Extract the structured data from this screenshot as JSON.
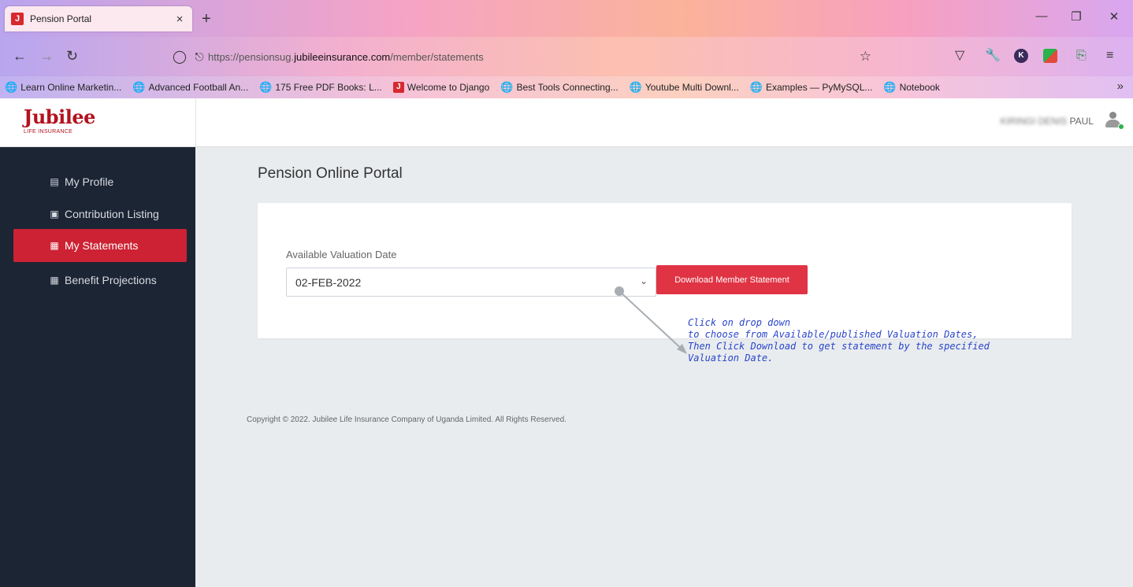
{
  "browser": {
    "tab_title": "Pension Portal",
    "tab_favicon": "J",
    "tab_close": "×",
    "new_tab": "+",
    "url_prefix": "https://pensionsug.",
    "url_host": "jubileeinsurance.com",
    "url_path": "/member/statements",
    "extension_k": "K",
    "bookmarks": [
      {
        "label": "Learn Online Marketin...",
        "icon": "globe-icon"
      },
      {
        "label": "Advanced Football An...",
        "icon": "globe-icon"
      },
      {
        "label": "175 Free PDF Books: L...",
        "icon": "globe-icon"
      },
      {
        "label": "Welcome to Django",
        "icon": "jubilee-favicon"
      },
      {
        "label": "Best Tools Connecting...",
        "icon": "globe-icon"
      },
      {
        "label": "Youtube Multi Downl...",
        "icon": "globe-icon"
      },
      {
        "label": "Examples — PyMySQL...",
        "icon": "globe-icon"
      },
      {
        "label": "Notebook",
        "icon": "globe-icon"
      }
    ]
  },
  "header": {
    "brand_name": "Jubilee",
    "brand_sub": "LIFE INSURANCE",
    "user_blurred": "KIRINGI DENIS",
    "user_last": "PAUL"
  },
  "sidebar": {
    "items": [
      {
        "label": "My Profile",
        "icon": "id-card-icon"
      },
      {
        "label": "Contribution Listing",
        "icon": "money-icon"
      },
      {
        "label": "My Statements",
        "icon": "newspaper-icon"
      },
      {
        "label": "Benefit Projections",
        "icon": "newspaper-icon"
      }
    ]
  },
  "main": {
    "title": "Pension Online Portal",
    "field_label": "Available Valuation Date",
    "selected_date": "02-FEB-2022",
    "download_label": "Download Member Statement",
    "annotation_lines": [
      "Click on drop down",
      "to choose from Available/published Valuation Dates,",
      "Then Click Download to get statement by the specified",
      "Valuation Date."
    ],
    "copyright": "Copyright © 2022. Jubilee Life Insurance Company of Uganda Limited. All Rights Reserved."
  },
  "colors": {
    "brand_red": "#b3121e",
    "active_red": "#cc2233",
    "button_red": "#e03444",
    "sidebar_bg": "#1c2534",
    "annotation_blue": "#2a45c8"
  }
}
